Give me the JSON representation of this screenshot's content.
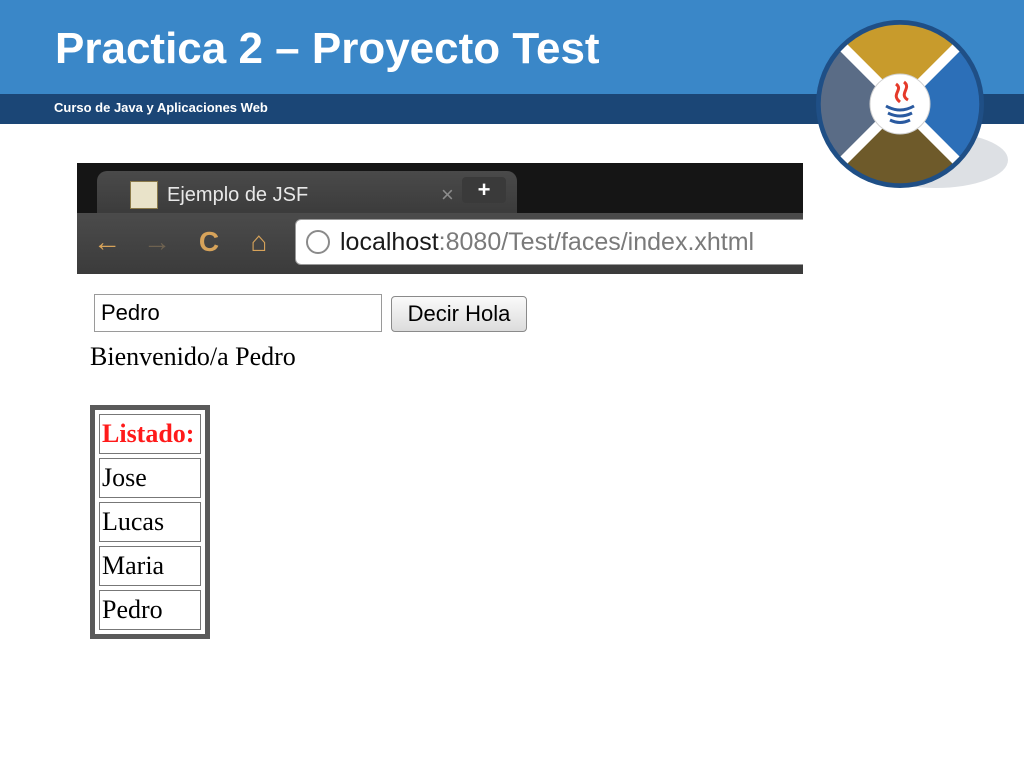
{
  "slide": {
    "title": "Practica 2 – Proyecto Test",
    "subtitle": "Curso de Java y Aplicaciones Web",
    "header_color": "#3a87c8",
    "band_color": "#1b4676",
    "logo_icon": "java-logo-icon"
  },
  "browser": {
    "tab_title": "Ejemplo de JSF",
    "tab_close": "×",
    "new_tab": "+",
    "back_icon": "←",
    "forward_icon": "→",
    "reload_icon": "C",
    "home_icon": "⌂",
    "url_host": "localhost",
    "url_rest": ":8080/Test/faces/index.xhtml"
  },
  "page": {
    "input_value": "Pedro",
    "button_label": "Decir Hola",
    "welcome": "Bienvenido/a Pedro",
    "listing_header": "Listado:",
    "listing_header_color": "#ff1a1a",
    "names": [
      "Jose",
      "Lucas",
      "Maria",
      "Pedro"
    ]
  }
}
